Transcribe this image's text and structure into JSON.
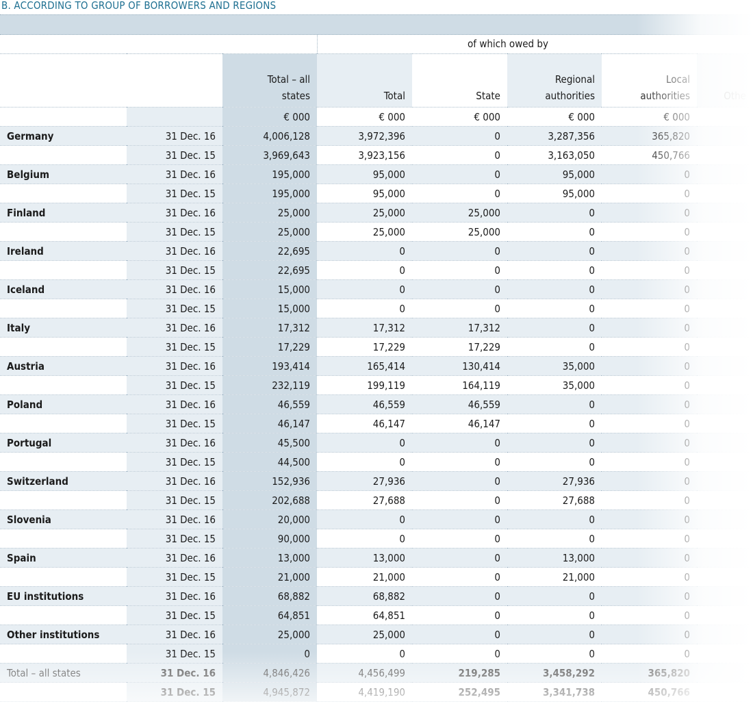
{
  "title": "B. ACCORDING TO GROUP OF BORROWERS AND REGIONS",
  "owed_by_label": "of which owed by",
  "columns": {
    "total_all_states_l1": "Total – all",
    "total_all_states_l2": "states",
    "total": "Total",
    "state": "State",
    "regional_l1": "Regional",
    "regional_l2": "authorities",
    "local_l1": "Local",
    "local_l2": "authorities",
    "other": "Othe"
  },
  "unit": "€ 000",
  "rows": [
    {
      "country": "Germany",
      "a": {
        "date": "31 Dec. 16",
        "v": [
          "4,006,128",
          "3,972,396",
          "0",
          "3,287,356",
          "365,820"
        ]
      },
      "b": {
        "date": "31 Dec. 15",
        "v": [
          "3,969,643",
          "3,923,156",
          "0",
          "3,163,050",
          "450,766"
        ]
      }
    },
    {
      "country": "Belgium",
      "a": {
        "date": "31 Dec. 16",
        "v": [
          "195,000",
          "95,000",
          "0",
          "95,000",
          "0"
        ]
      },
      "b": {
        "date": "31 Dec. 15",
        "v": [
          "195,000",
          "95,000",
          "0",
          "95,000",
          "0"
        ]
      }
    },
    {
      "country": "Finland",
      "a": {
        "date": "31 Dec. 16",
        "v": [
          "25,000",
          "25,000",
          "25,000",
          "0",
          "0"
        ]
      },
      "b": {
        "date": "31 Dec. 15",
        "v": [
          "25,000",
          "25,000",
          "25,000",
          "0",
          "0"
        ]
      }
    },
    {
      "country": "Ireland",
      "a": {
        "date": "31 Dec. 16",
        "v": [
          "22,695",
          "0",
          "0",
          "0",
          "0"
        ]
      },
      "b": {
        "date": "31 Dec. 15",
        "v": [
          "22,695",
          "0",
          "0",
          "0",
          "0"
        ]
      }
    },
    {
      "country": "Iceland",
      "a": {
        "date": "31 Dec. 16",
        "v": [
          "15,000",
          "0",
          "0",
          "0",
          "0"
        ]
      },
      "b": {
        "date": "31 Dec. 15",
        "v": [
          "15,000",
          "0",
          "0",
          "0",
          "0"
        ]
      }
    },
    {
      "country": "Italy",
      "a": {
        "date": "31 Dec. 16",
        "v": [
          "17,312",
          "17,312",
          "17,312",
          "0",
          "0"
        ]
      },
      "b": {
        "date": "31 Dec. 15",
        "v": [
          "17,229",
          "17,229",
          "17,229",
          "0",
          "0"
        ]
      }
    },
    {
      "country": "Austria",
      "a": {
        "date": "31 Dec. 16",
        "v": [
          "193,414",
          "165,414",
          "130,414",
          "35,000",
          "0"
        ]
      },
      "b": {
        "date": "31 Dec. 15",
        "v": [
          "232,119",
          "199,119",
          "164,119",
          "35,000",
          "0"
        ]
      }
    },
    {
      "country": "Poland",
      "a": {
        "date": "31 Dec. 16",
        "v": [
          "46,559",
          "46,559",
          "46,559",
          "0",
          "0"
        ]
      },
      "b": {
        "date": "31 Dec. 15",
        "v": [
          "46,147",
          "46,147",
          "46,147",
          "0",
          "0"
        ]
      }
    },
    {
      "country": "Portugal",
      "a": {
        "date": "31 Dec. 16",
        "v": [
          "45,500",
          "0",
          "0",
          "0",
          "0"
        ]
      },
      "b": {
        "date": "31 Dec. 15",
        "v": [
          "44,500",
          "0",
          "0",
          "0",
          "0"
        ]
      }
    },
    {
      "country": "Switzerland",
      "a": {
        "date": "31 Dec. 16",
        "v": [
          "152,936",
          "27,936",
          "0",
          "27,936",
          "0"
        ]
      },
      "b": {
        "date": "31 Dec. 15",
        "v": [
          "202,688",
          "27,688",
          "0",
          "27,688",
          "0"
        ]
      }
    },
    {
      "country": "Slovenia",
      "a": {
        "date": "31 Dec. 16",
        "v": [
          "20,000",
          "0",
          "0",
          "0",
          "0"
        ]
      },
      "b": {
        "date": "31 Dec. 15",
        "v": [
          "90,000",
          "0",
          "0",
          "0",
          "0"
        ]
      }
    },
    {
      "country": "Spain",
      "a": {
        "date": "31 Dec. 16",
        "v": [
          "13,000",
          "13,000",
          "0",
          "13,000",
          "0"
        ]
      },
      "b": {
        "date": "31 Dec. 15",
        "v": [
          "21,000",
          "21,000",
          "0",
          "21,000",
          "0"
        ]
      }
    },
    {
      "country": "EU institutions",
      "a": {
        "date": "31 Dec. 16",
        "v": [
          "68,882",
          "68,882",
          "0",
          "0",
          "0"
        ]
      },
      "b": {
        "date": "31 Dec. 15",
        "v": [
          "64,851",
          "64,851",
          "0",
          "0",
          "0"
        ]
      }
    },
    {
      "country": "Other institutions",
      "a": {
        "date": "31 Dec. 16",
        "v": [
          "25,000",
          "25,000",
          "0",
          "0",
          "0"
        ]
      },
      "b": {
        "date": "31 Dec. 15",
        "v": [
          "0",
          "0",
          "0",
          "0",
          "0"
        ]
      }
    }
  ],
  "total_row": {
    "label": "Total – all states",
    "a": {
      "date": "31 Dec. 16",
      "v": [
        "4,846,426",
        "4,456,499",
        "219,285",
        "3,458,292",
        "365,820"
      ]
    },
    "b": {
      "date": "31 Dec. 15",
      "v": [
        "4,945,872",
        "4,419,190",
        "252,495",
        "3,341,738",
        "450,766"
      ]
    }
  }
}
